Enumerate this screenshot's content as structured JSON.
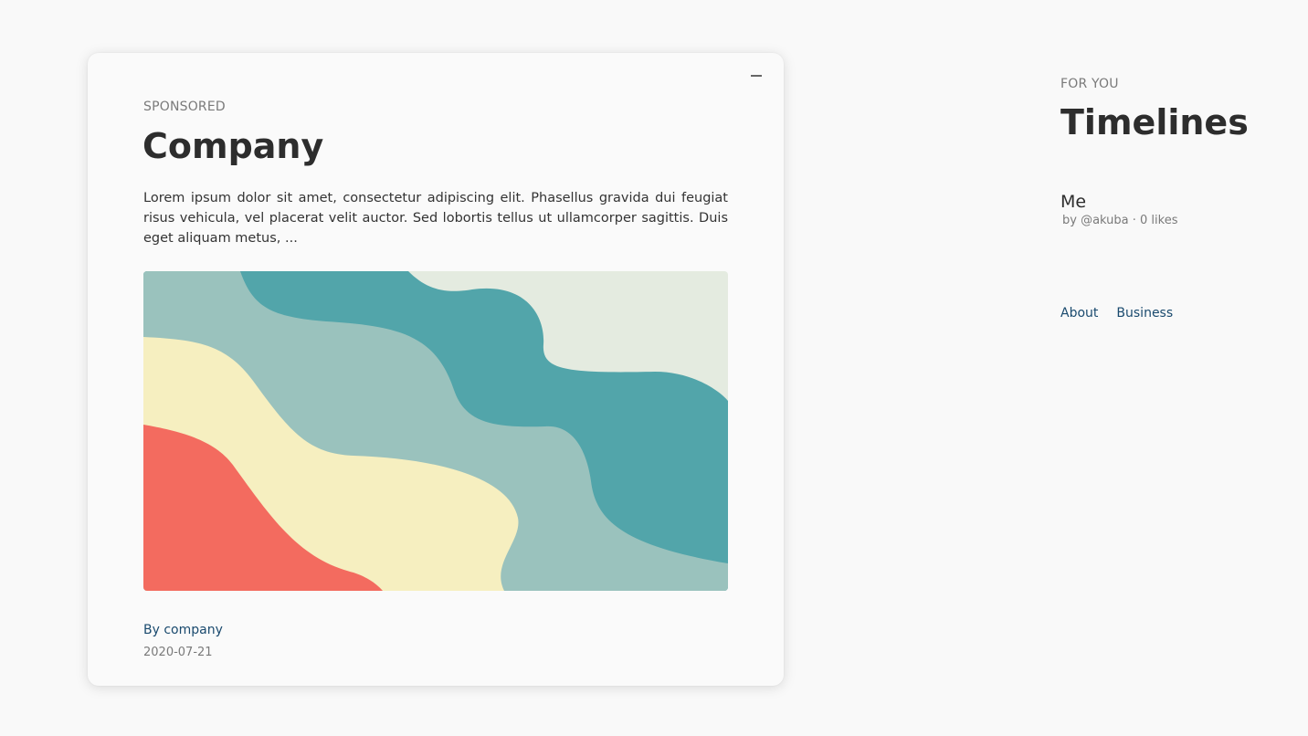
{
  "card": {
    "eyebrow": "SPONSORED",
    "title": "Company",
    "body": "Lorem ipsum dolor sit amet, consectetur adipiscing elit. Phasellus gravida dui feugiat risus vehicula, vel placerat velit auctor. Sed lobortis tellus ut ullamcorper sagittis. Duis eget aliquam metus, ...",
    "by_prefix": "By ",
    "author": "company",
    "date": "2020-07-21",
    "minimize_icon": "minimize-icon",
    "hero_colors": {
      "background": "#e4ebe0",
      "teal": "#52a5aa",
      "sage": "#9ac2bd",
      "cream": "#f6efc0",
      "coral": "#f36b5f"
    }
  },
  "sidebar": {
    "eyebrow": "FOR YOU",
    "title": "Timelines",
    "timeline": {
      "name": "Me",
      "meta": "by @akuba · 0 likes"
    },
    "links": [
      "About",
      "Business"
    ]
  }
}
